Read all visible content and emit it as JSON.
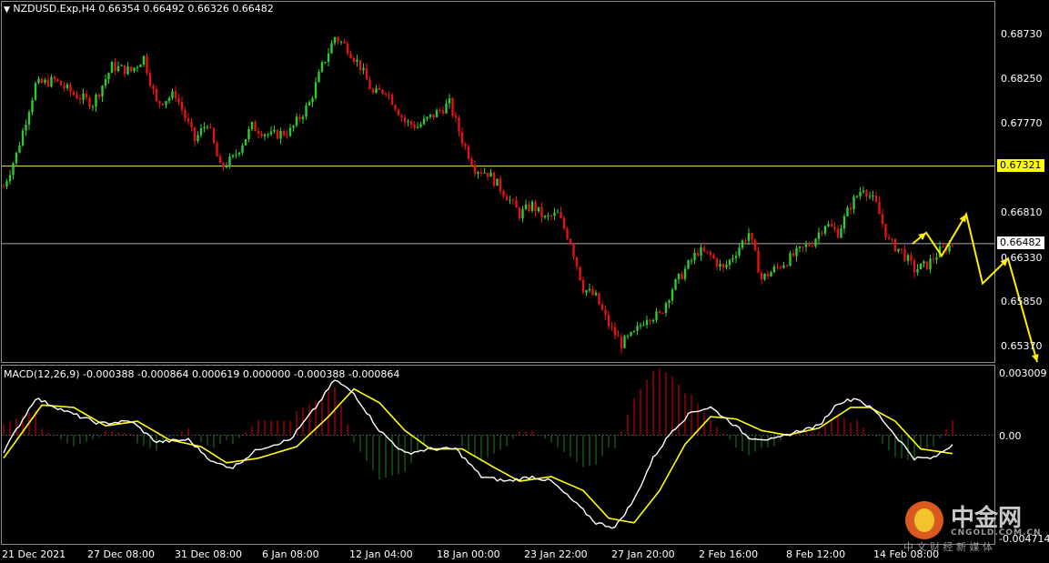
{
  "header": {
    "symbol_line": "NZDUSD.Exp,H4  0.66354 0.66492 0.66326 0.66482",
    "macd_line": "MACD(12,26,9) -0.000388 -0.000864 0.000619 0.000000 -0.000388 -0.000864"
  },
  "price_axis": [
    "0.68730",
    "0.68250",
    "0.67770",
    "0.67321",
    "0.66810",
    "0.66482",
    "0.66330",
    "0.65850",
    "0.65370"
  ],
  "macd_axis": [
    "0.003009",
    "0.00",
    "-0.004714"
  ],
  "x_axis": [
    "21 Dec 2021",
    "27 Dec 08:00",
    "31 Dec 08:00",
    "6 Jan 08:00",
    "12 Jan 04:00",
    "18 Jan 00:00",
    "23 Jan 22:00",
    "27 Jan 20:00",
    "2 Feb 16:00",
    "8 Feb 12:00",
    "14 Feb 08:00"
  ],
  "horizontal_lines": {
    "resistance": "0.67321",
    "current": "0.66482"
  },
  "colors": {
    "bull": "#2ecc2e",
    "bear": "#e81010",
    "macd": "#ffffff",
    "signal": "#ffff00",
    "hist_pos": "#c00000",
    "hist_neg": "#1a6b1a",
    "arrow": "#ffee00",
    "tag_yellow": "#ffff00",
    "tag_white": "#ffffff"
  },
  "logo": {
    "name": "中金网",
    "domain": "CNGOLD.COM.CN",
    "slogan": "中 文 财 经 新 媒 体"
  },
  "chart_data": {
    "type": "candlestick",
    "ylim": [
      0.652,
      0.691
    ],
    "anchors": [
      [
        0,
        0.671
      ],
      [
        4,
        0.6745
      ],
      [
        10,
        0.682
      ],
      [
        16,
        0.6825
      ],
      [
        22,
        0.681
      ],
      [
        28,
        0.68
      ],
      [
        34,
        0.684
      ],
      [
        40,
        0.6835
      ],
      [
        44,
        0.685
      ],
      [
        48,
        0.68
      ],
      [
        54,
        0.681
      ],
      [
        60,
        0.676
      ],
      [
        64,
        0.678
      ],
      [
        68,
        0.673
      ],
      [
        72,
        0.674
      ],
      [
        78,
        0.6775
      ],
      [
        84,
        0.6765
      ],
      [
        90,
        0.677
      ],
      [
        96,
        0.68
      ],
      [
        100,
        0.684
      ],
      [
        104,
        0.6872
      ],
      [
        108,
        0.686
      ],
      [
        112,
        0.684
      ],
      [
        116,
        0.681
      ],
      [
        120,
        0.6815
      ],
      [
        126,
        0.678
      ],
      [
        130,
        0.6775
      ],
      [
        136,
        0.679
      ],
      [
        140,
        0.68
      ],
      [
        144,
        0.676
      ],
      [
        148,
        0.673
      ],
      [
        152,
        0.6725
      ],
      [
        158,
        0.67
      ],
      [
        162,
        0.668
      ],
      [
        166,
        0.669
      ],
      [
        170,
        0.6675
      ],
      [
        174,
        0.668
      ],
      [
        178,
        0.665
      ],
      [
        182,
        0.66
      ],
      [
        186,
        0.659
      ],
      [
        190,
        0.656
      ],
      [
        194,
        0.654
      ],
      [
        198,
        0.655
      ],
      [
        202,
        0.657
      ],
      [
        206,
        0.657
      ],
      [
        210,
        0.66
      ],
      [
        214,
        0.662
      ],
      [
        218,
        0.664
      ],
      [
        222,
        0.6635
      ],
      [
        226,
        0.662
      ],
      [
        230,
        0.664
      ],
      [
        234,
        0.666
      ],
      [
        238,
        0.661
      ],
      [
        242,
        0.662
      ],
      [
        246,
        0.663
      ],
      [
        250,
        0.664
      ],
      [
        254,
        0.665
      ],
      [
        258,
        0.667
      ],
      [
        262,
        0.666
      ],
      [
        266,
        0.669
      ],
      [
        270,
        0.671
      ],
      [
        274,
        0.669
      ],
      [
        278,
        0.665
      ],
      [
        282,
        0.664
      ],
      [
        286,
        0.662
      ],
      [
        290,
        0.6625
      ],
      [
        294,
        0.664
      ],
      [
        298,
        0.6648
      ]
    ],
    "macd": [
      [
        0,
        -0.0007
      ],
      [
        10,
        0.0016
      ],
      [
        20,
        0.001
      ],
      [
        30,
        0.0005
      ],
      [
        40,
        0.0006
      ],
      [
        48,
        -0.0003
      ],
      [
        58,
        -0.0002
      ],
      [
        66,
        -0.0012
      ],
      [
        72,
        -0.0014
      ],
      [
        80,
        -0.0006
      ],
      [
        90,
        -0.0002
      ],
      [
        98,
        0.0012
      ],
      [
        104,
        0.0024
      ],
      [
        110,
        0.0018
      ],
      [
        118,
        0.0002
      ],
      [
        126,
        -0.0008
      ],
      [
        134,
        -0.0006
      ],
      [
        142,
        -0.0006
      ],
      [
        150,
        -0.0018
      ],
      [
        158,
        -0.002
      ],
      [
        166,
        -0.0018
      ],
      [
        172,
        -0.002
      ],
      [
        180,
        -0.003
      ],
      [
        186,
        -0.0038
      ],
      [
        192,
        -0.004
      ],
      [
        198,
        -0.0028
      ],
      [
        204,
        -0.001
      ],
      [
        210,
        0.0002
      ],
      [
        216,
        0.001
      ],
      [
        222,
        0.0012
      ],
      [
        228,
        0.0006
      ],
      [
        234,
        -0.0001
      ],
      [
        242,
        -0.0002
      ],
      [
        250,
        0.0002
      ],
      [
        256,
        0.0004
      ],
      [
        262,
        0.0014
      ],
      [
        268,
        0.0016
      ],
      [
        274,
        0.001
      ],
      [
        280,
        0.0
      ],
      [
        286,
        -0.001
      ],
      [
        292,
        -0.001
      ],
      [
        298,
        -0.0004
      ]
    ],
    "signal": [
      [
        0,
        -0.001
      ],
      [
        12,
        0.0013
      ],
      [
        22,
        0.0012
      ],
      [
        32,
        0.0004
      ],
      [
        42,
        0.0006
      ],
      [
        52,
        -0.0002
      ],
      [
        62,
        -0.0005
      ],
      [
        70,
        -0.0012
      ],
      [
        80,
        -0.001
      ],
      [
        92,
        -0.0005
      ],
      [
        102,
        0.0008
      ],
      [
        110,
        0.002
      ],
      [
        118,
        0.0014
      ],
      [
        126,
        0.0002
      ],
      [
        134,
        -0.0006
      ],
      [
        144,
        -0.0006
      ],
      [
        154,
        -0.0014
      ],
      [
        162,
        -0.002
      ],
      [
        172,
        -0.0018
      ],
      [
        182,
        -0.0024
      ],
      [
        190,
        -0.0036
      ],
      [
        198,
        -0.0038
      ],
      [
        206,
        -0.0024
      ],
      [
        214,
        -0.0004
      ],
      [
        222,
        0.0008
      ],
      [
        230,
        0.0007
      ],
      [
        238,
        0.0002
      ],
      [
        246,
        0.0
      ],
      [
        256,
        0.0003
      ],
      [
        266,
        0.0012
      ],
      [
        272,
        0.0012
      ],
      [
        280,
        0.0006
      ],
      [
        288,
        -0.0006
      ],
      [
        298,
        -0.0008
      ]
    ],
    "macd_ylim": [
      -0.004714,
      0.003009
    ],
    "forecast_arrow": [
      [
        0.6648,
        0.666
      ],
      [
        0.664,
        0.669
      ],
      [
        0.6605,
        0.6632
      ],
      [
        0.652,
        0.652
      ]
    ]
  }
}
